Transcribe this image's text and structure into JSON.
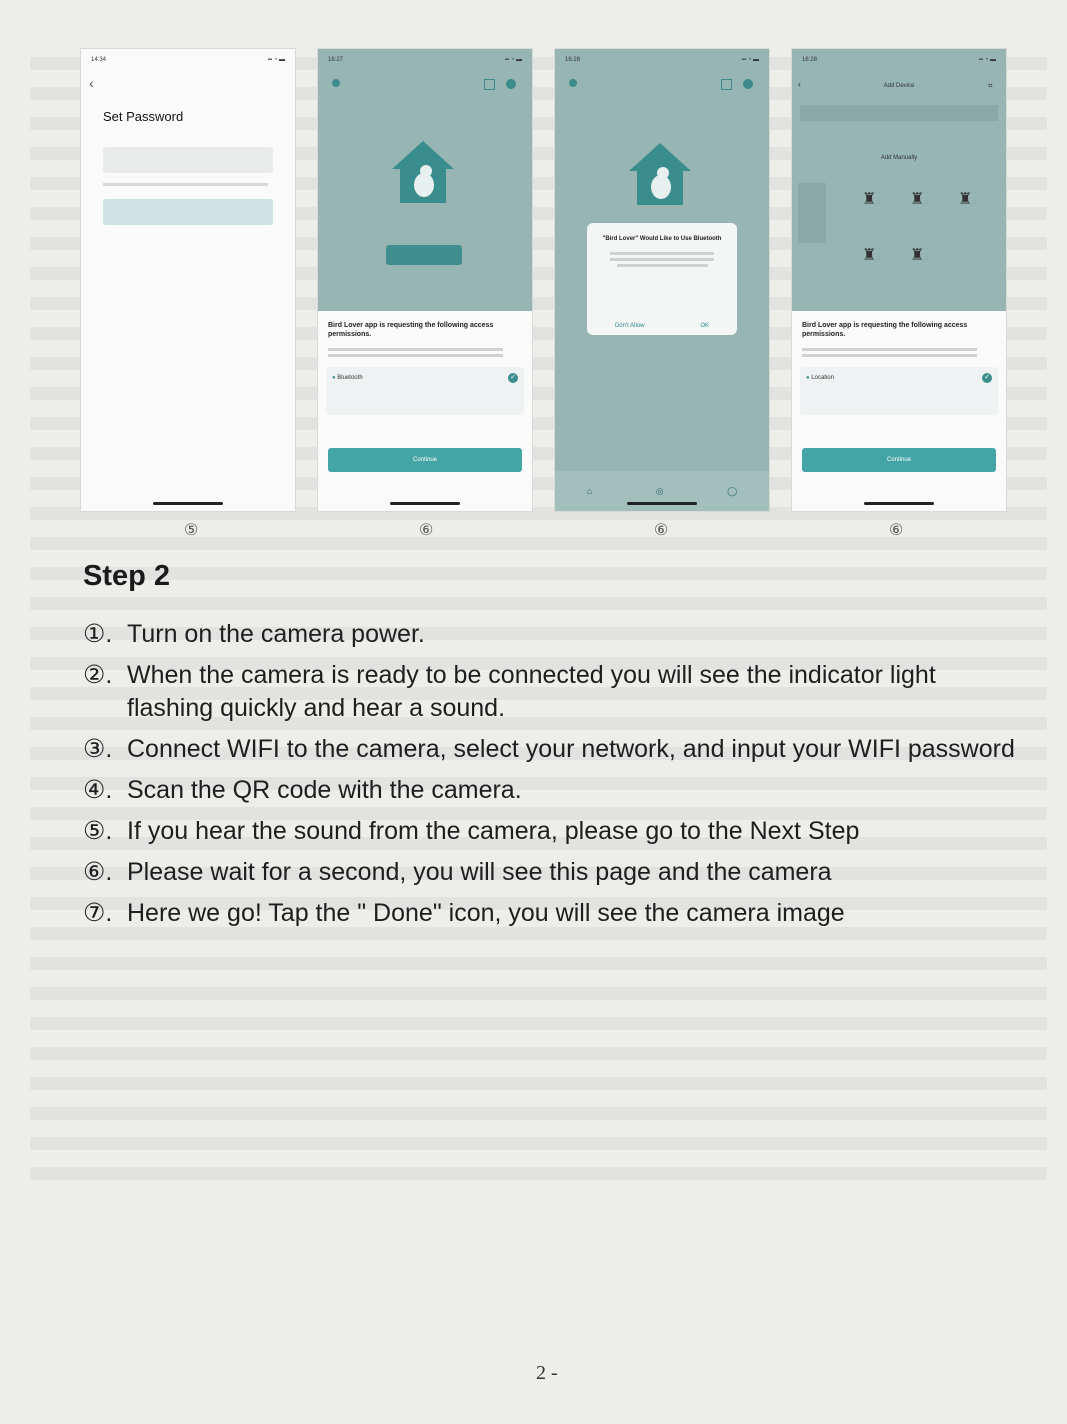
{
  "phones": [
    {
      "status_time": "14:34",
      "back": "‹",
      "title": "Set Password",
      "marker": "⑤"
    },
    {
      "status_time": "16:27",
      "sheet_title": "Bird Lover app is requesting the following access permissions.",
      "permission": "Bluetooth",
      "button": "Continue",
      "marker": "⑥"
    },
    {
      "status_time": "16:28",
      "dialog_title": "\"Bird Lover\" Would Like to Use Bluetooth",
      "dont_allow": "Don't Allow",
      "ok": "OK",
      "marker": "⑥"
    },
    {
      "status_time": "16:28",
      "title": "Add Device",
      "section": "Add Manually",
      "sheet_title": "Bird Lover app is requesting the following access permissions.",
      "permission": "Location",
      "button": "Continue",
      "marker": "⑥"
    }
  ],
  "step_title": "Step 2",
  "steps": [
    {
      "num": "①.",
      "text": "Turn on the camera power."
    },
    {
      "num": "②.",
      "text": "When the camera is ready to be connected you will see the indicator light flashing quickly and hear a sound."
    },
    {
      "num": "③.",
      "text": "Connect WIFI to the camera, select your network, and input your WIFI password"
    },
    {
      "num": "④.",
      "text": "Scan the QR code with the camera."
    },
    {
      "num": "⑤.",
      "text": "If you hear the sound from the camera, please go to the Next Step"
    },
    {
      "num": "⑥.",
      "text": "Please wait for a second, you will see this page and the camera"
    },
    {
      "num": "⑦.",
      "text": "Here we go! Tap the \" Done\" icon, you will see the camera image"
    }
  ],
  "page_number": "2 -"
}
